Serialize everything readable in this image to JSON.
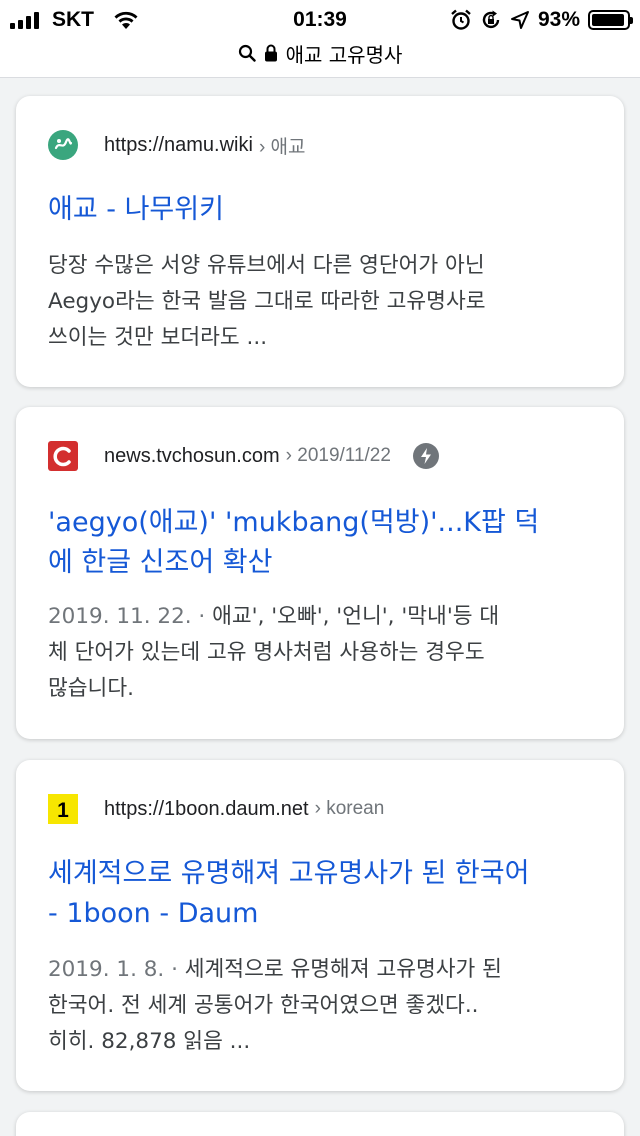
{
  "status_bar": {
    "carrier": "SKT",
    "time": "01:39",
    "battery": "93%",
    "battery_level": 0.93
  },
  "address_bar": {
    "query": "애교 고유명사"
  },
  "results": [
    {
      "site": "https://namu.wiki",
      "crumb": "› 애교",
      "title": "애교 - 나무위키",
      "date": "",
      "snippet_lines": [
        "당장 수많은 서양 유튜브에서 다른 영단어가 아닌",
        "Aegyo라는 한국 발음 그대로 따라한 고유명사로",
        "쓰이는 것만 보더라도 ..."
      ]
    },
    {
      "site": "news.tvchosun.com",
      "crumb": "› 2019/11/22",
      "title_lines": [
        "'aegyo(애교)' 'mukbang(먹방)'...K팝 덕",
        "에 한글 신조어 확산"
      ],
      "date": "2019. 11. 22. · ",
      "snippet_lines": [
        "애교', '오빠', '언니', '막내'등 대",
        "체 단어가 있는데 고유 명사처럼 사용하는 경우도",
        "많습니다."
      ]
    },
    {
      "site": "https://1boon.daum.net",
      "crumb": "› korean",
      "title_lines": [
        "세계적으로 유명해져 고유명사가 된 한국어",
        "- 1boon - Daum"
      ],
      "date": "2019. 1. 8. · ",
      "snippet_lines": [
        "세계적으로 유명해져 고유명사가 된",
        "한국어. 전 세계 공통어가 한국어였으면 좋겠다..",
        "히히. 82,878 읽음 ..."
      ]
    }
  ],
  "colors": {
    "link": "#1558d6",
    "meta": "#70757a",
    "namu_green": "#3aa67e",
    "tvchosun_red": "#d32f2f",
    "daum_yellow": "#f7e600"
  },
  "icons": [
    "signal-icon",
    "wifi-icon",
    "alarm-icon",
    "rotation-lock-icon",
    "location-arrow-icon",
    "battery-icon",
    "search-icon",
    "lock-icon",
    "namu-favicon-icon",
    "tvchosun-favicon-icon",
    "1boon-favicon-icon",
    "amp-lightning-icon"
  ]
}
